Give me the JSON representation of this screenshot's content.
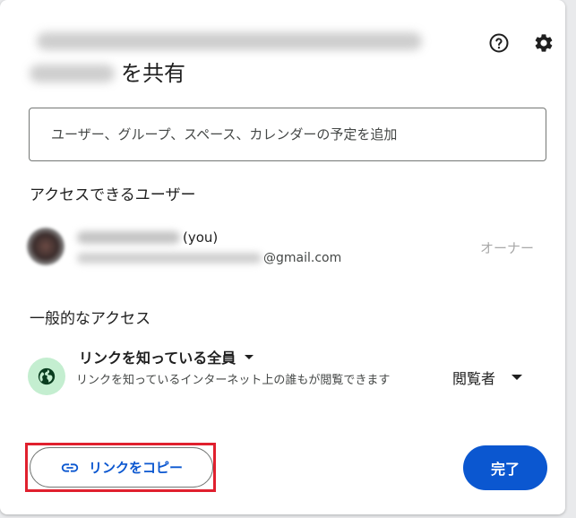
{
  "dialog": {
    "title_suffix": "を共有",
    "help_icon": "help-circle-icon",
    "settings_icon": "gear-icon"
  },
  "add_people": {
    "placeholder": "ユーザー、グループ、スペース、カレンダーの予定を追加"
  },
  "people_section": {
    "heading": "アクセスできるユーザー",
    "owner": {
      "you_label": "(you)",
      "email_domain": "@gmail.com",
      "role": "オーナー"
    }
  },
  "general_access": {
    "heading": "一般的なアクセス",
    "icon": "globe-icon",
    "link_setting": "リンクを知っている全員",
    "description": "リンクを知っているインターネット上の誰もが閲覧できます",
    "role": "閲覧者"
  },
  "footer": {
    "copy_link_label": "リンクをコピー",
    "copy_link_icon": "link-icon",
    "done_label": "完了"
  },
  "colors": {
    "primary": "#0b57d0",
    "highlight_border": "#e0202e",
    "globe_bg": "#c4eed0",
    "globe_icon": "#0a3d1f"
  }
}
